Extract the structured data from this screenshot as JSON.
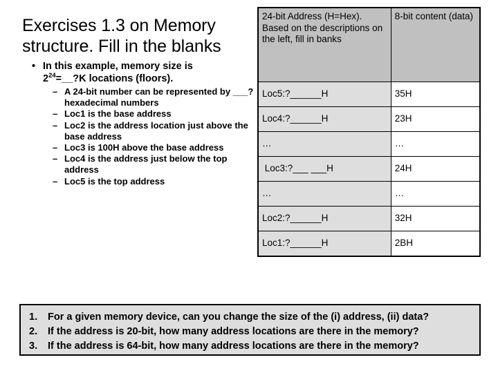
{
  "slide": {
    "title": "Exercises 1.3 on Memory\nstructure. Fill in the blanks"
  },
  "bullets": {
    "main": {
      "marker": "•",
      "line1": "In this example, memory size is",
      "line2_prefix": "2",
      "line2_exponent": "24",
      "line2_suffix": "=__?K locations (floors)."
    },
    "sub_marker": "–",
    "sub_items": [
      "A 24-bit number can be represented by ___? hexadecimal numbers",
      "Loc1 is the base address",
      "Loc2 is the address location just above the base address",
      "Loc3 is 100H above the base address",
      "Loc4 is the address just below the top address",
      "Loc5 is the top address"
    ]
  },
  "table": {
    "headers": {
      "address": "24-bit Address (H=Hex). Based on the descriptions on the left, fill in banks",
      "content": "8-bit content (data)"
    },
    "rows": [
      {
        "address": "Loc5:?______H",
        "data": "35H"
      },
      {
        "address": "Loc4:?______H",
        "data": "23H"
      },
      {
        "address": "…",
        "data": "…"
      },
      {
        "address": " Loc3:?___ ___H",
        "data": "24H"
      },
      {
        "address": "…",
        "data": "…"
      },
      {
        "address": "Loc2:?______H",
        "data": "32H"
      },
      {
        "address": "Loc1:?______H",
        "data": "2BH"
      }
    ]
  },
  "questions": [
    {
      "num": "1.",
      "text": "For a given memory device, can you change the size of the (i) address, (ii) data?"
    },
    {
      "num": "2.",
      "text": "If the address is 20-bit, how many address locations are there in the memory?"
    },
    {
      "num": "3.",
      "text": "If the address is 64-bit, how many address locations are there in the memory?"
    }
  ],
  "colors": {
    "header_gray": "#c0c0c0",
    "cell_gray": "#dedede",
    "border": "#000000"
  }
}
